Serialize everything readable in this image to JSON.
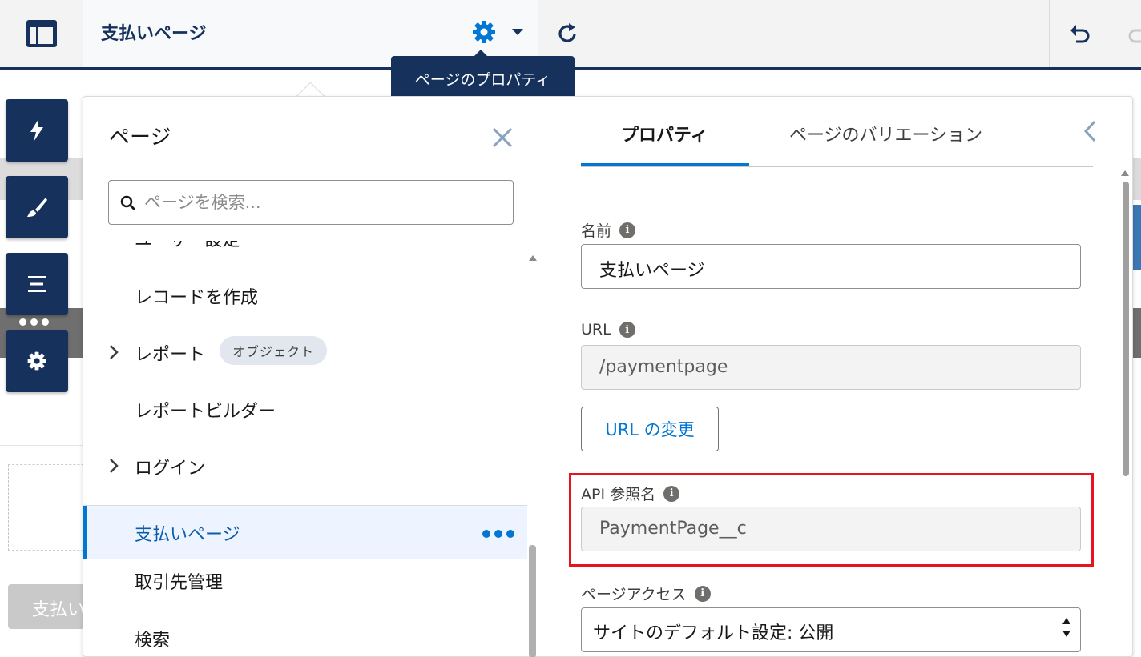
{
  "header": {
    "current_page": "支払いページ",
    "tooltip": "ページのプロパティ"
  },
  "canvas": {
    "button_label": "支払い"
  },
  "pages_panel": {
    "title": "ページ",
    "search_placeholder": "ページを検索...",
    "items": [
      {
        "label": "ユーザー設定",
        "expandable": false,
        "partial": true
      },
      {
        "label": "レコードを作成",
        "expandable": false
      },
      {
        "label": "レポート",
        "expandable": true,
        "badge": "オブジェクト"
      },
      {
        "label": "レポートビルダー",
        "expandable": false
      },
      {
        "label": "ログイン",
        "expandable": true
      },
      {
        "label": "支払いページ",
        "expandable": false,
        "selected": true
      },
      {
        "label": "取引先管理",
        "expandable": false
      },
      {
        "label": "検索",
        "expandable": false
      }
    ]
  },
  "properties": {
    "tabs": [
      "プロパティ",
      "ページのバリエーション"
    ],
    "active_tab": "プロパティ",
    "name_label": "名前",
    "name_value": "支払いページ",
    "url_label": "URL",
    "url_value": "/paymentpage",
    "change_url_button": "URL の変更",
    "api_name_label": "API 参照名",
    "api_name_value": "PaymentPage__c",
    "access_label": "ページアクセス",
    "access_value": "サイトのデフォルト設定: 公開"
  },
  "colors": {
    "brand_navy": "#16325c",
    "accent_blue": "#0176d3",
    "highlight_red": "#e5141e"
  },
  "icons": {
    "layout": "layout-icon",
    "gear": "gear-icon",
    "refresh": "refresh-icon",
    "undo": "undo-icon",
    "redo": "redo-icon",
    "rail": [
      "lightning-icon",
      "brush-icon",
      "list-icon",
      "gear-icon"
    ]
  }
}
